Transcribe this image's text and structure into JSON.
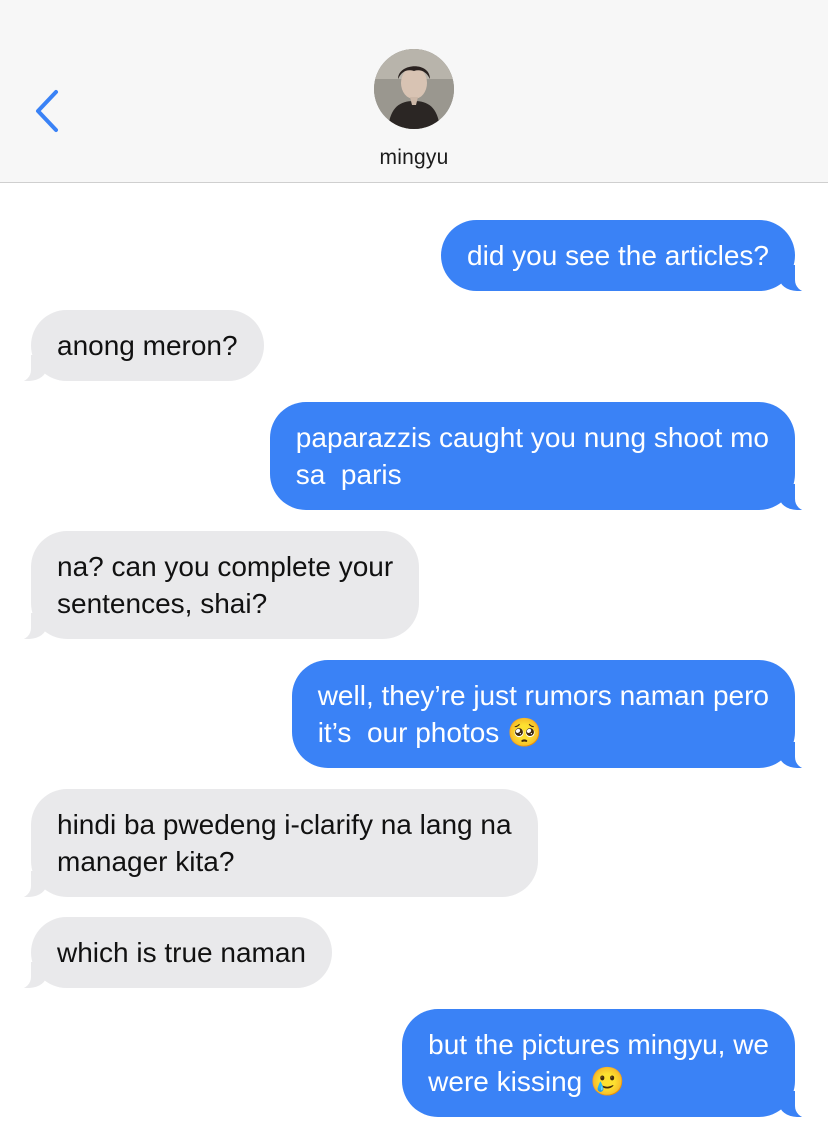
{
  "header": {
    "contact_name": "mingyu",
    "back_icon": "chevron-left-icon",
    "accent_color": "#3a82f6"
  },
  "messages": [
    {
      "from": "me",
      "text": "did you see the articles?"
    },
    {
      "from": "them",
      "text": "anong meron?"
    },
    {
      "from": "me",
      "text": "paparazzis caught you nung shoot mo\nsa  paris"
    },
    {
      "from": "them",
      "text": "na? can you complete your\nsentences, shai?"
    },
    {
      "from": "me",
      "text": "well, they’re just rumors naman pero\nit’s  our photos 🥺"
    },
    {
      "from": "them",
      "text": "hindi ba pwedeng i-clarify na lang na\nmanager kita?"
    },
    {
      "from": "them",
      "text": "which is true naman"
    },
    {
      "from": "me",
      "text": "but the pictures mingyu, we\nwere kissing 🥲"
    }
  ]
}
